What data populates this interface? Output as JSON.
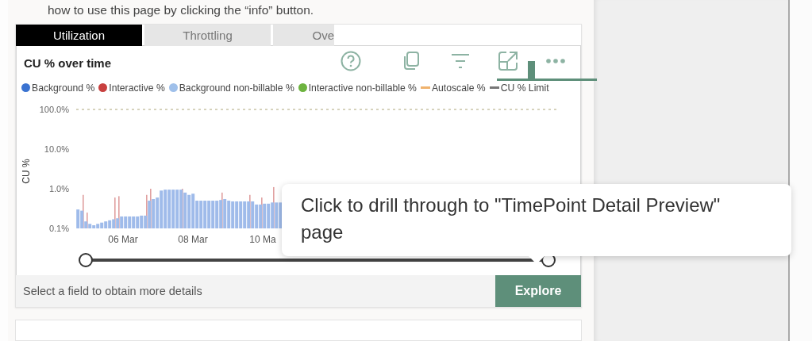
{
  "intro": {
    "text": "how to use this page by clicking the “info” button."
  },
  "tabs": [
    {
      "label": "Utilization",
      "selected": true
    },
    {
      "label": "Throttling",
      "selected": false
    },
    {
      "label": "Ove",
      "selected": false
    }
  ],
  "visual": {
    "title": "CU % over time",
    "legend": [
      {
        "label": "Background %",
        "color": "#3a73d1",
        "kind": "dot"
      },
      {
        "label": "Interactive %",
        "color": "#c8403f",
        "kind": "dot"
      },
      {
        "label": "Background non-billable %",
        "color": "#9fc0ea",
        "kind": "dot"
      },
      {
        "label": "Interactive non-billable %",
        "color": "#6db33f",
        "kind": "dot"
      },
      {
        "label": "Autoscale %",
        "color": "#f0b26d",
        "kind": "line"
      },
      {
        "label": "CU % Limit",
        "color": "#777777",
        "kind": "line"
      }
    ],
    "chart": {
      "y_axis_title": "CU %",
      "y_tick_labels": [
        "100.0%",
        "10.0%",
        "1.0%",
        "0.1%"
      ],
      "x_tick_labels": [
        "06 Mar",
        "08 Mar",
        "10 Ma"
      ]
    },
    "slider": {
      "level": 1
    },
    "footer": {
      "text": "Select a field to obtain more details"
    },
    "button": {
      "label": "Explore"
    }
  },
  "tooltip": {
    "text": "Click to drill through to \"TimePoint Detail Preview\" page"
  }
}
